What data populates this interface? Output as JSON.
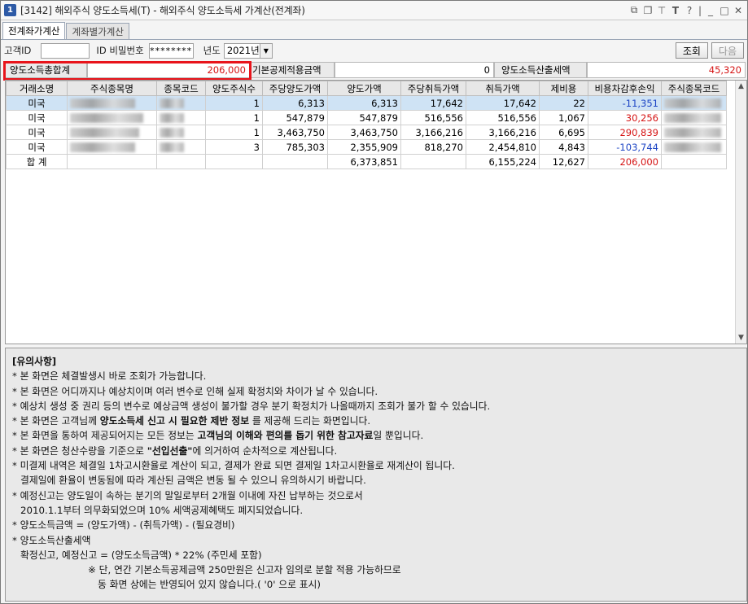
{
  "window": {
    "title_num": "1",
    "title": "[3142] 해외주식 양도소득세(T) - 해외주식 양도소득세 가계산(전계좌)"
  },
  "tabs": [
    "전계좌가계산",
    "계좌별가계산"
  ],
  "filters": {
    "customer_id_label": "고객ID",
    "id_pw_label": "ID 비밀번호",
    "id_pw_value": "********",
    "year_label": "년도",
    "year_value": "2021년",
    "query_button": "조회",
    "next_button": "다음"
  },
  "summary": {
    "total_gain_label": "양도소득총합계",
    "total_gain_value": "206,000",
    "basic_deduction_label": "기본공제적용금액",
    "basic_deduction_value": "0",
    "tax_label": "양도소득산출세액",
    "tax_value": "45,320"
  },
  "table": {
    "headers": [
      "거래소명",
      "주식종목명",
      "종목코드",
      "양도주식수",
      "주당양도가액",
      "양도가액",
      "주당취득가액",
      "취득가액",
      "제비용",
      "비용차감후손익",
      "주식종목코드"
    ],
    "rows": [
      {
        "market": "미국",
        "qty": "1",
        "unit_sell": "6,313",
        "sell": "6,313",
        "unit_buy": "17,642",
        "buy": "17,642",
        "fee": "22",
        "pnl": "-11,351",
        "pnl_color": "blue"
      },
      {
        "market": "미국",
        "qty": "1",
        "unit_sell": "547,879",
        "sell": "547,879",
        "unit_buy": "516,556",
        "buy": "516,556",
        "fee": "1,067",
        "pnl": "30,256",
        "pnl_color": "red"
      },
      {
        "market": "미국",
        "qty": "1",
        "unit_sell": "3,463,750",
        "sell": "3,463,750",
        "unit_buy": "3,166,216",
        "buy": "3,166,216",
        "fee": "6,695",
        "pnl": "290,839",
        "pnl_color": "red"
      },
      {
        "market": "미국",
        "qty": "3",
        "unit_sell": "785,303",
        "sell": "2,355,909",
        "unit_buy": "818,270",
        "buy": "2,454,810",
        "fee": "4,843",
        "pnl": "-103,744",
        "pnl_color": "blue"
      }
    ],
    "total": {
      "label": "합 계",
      "sell": "6,373,851",
      "buy": "6,155,224",
      "fee": "12,627",
      "pnl": "206,000"
    }
  },
  "notes": {
    "title": "[유의사항]",
    "l1": "* 본 화면은 체결발생시 바로 조회가 가능합니다.",
    "l2": "* 본 화면은 어디까지나 예상치이며 여러 변수로 인해 실제 확정치와 차이가 날 수 있습니다.",
    "l3": "* 예상치 생성 중 권리 등의 변수로 예상금액 생성이 불가할 경우 분기 확정치가 나올때까지 조회가 불가 할 수 있습니다.",
    "l4a": "* 본 화면은 고객님께 ",
    "l4b": "양도소득세 신고 시 필요한 제반 정보",
    "l4c": " 를 제공해 드리는 화면입니다.",
    "l5a": "* 본 화면을 통하여 제공되어지는 모든 정보는 ",
    "l5b": "고객님의 이해와 편의를 돕기 위한 참고자료",
    "l5c": "일 뿐입니다.",
    "l6a": "* 본 화면은 청산수량을 기준으로 ",
    "l6b": "\"선입선출\"",
    "l6c": "에 의거하여 순차적으로 계산됩니다.",
    "l7": "* 미결제 내역은 체결일 1차고시환율로 계산이 되고, 결제가 완료 되면 결제일 1차고시환율로 재계산이 됩니다.",
    "l8": "결제일에 환율이 변동됨에 따라 계산된 금액은 변동 될 수 있으니 유의하시기 바랍니다.",
    "l9": "* 예정신고는 양도일이 속하는 분기의 말일로부터 2개월 이내에 자진 납부하는 것으로서",
    "l10": "2010.1.1부터 의무화되었으며 10% 세액공제혜택도 폐지되었습니다.",
    "l11": "* 양도소득금액 = (양도가액) - (취득가액)  - (필요경비)",
    "l12": "* 양도소득산출세액",
    "l13": "확정신고, 예정신고 = (양도소득금액) * 22% (주민세 포함)",
    "l14": "※ 단, 연간 기본소득공제금액 250만원은 신고자 임의로 분할 적용 가능하므로",
    "l15": "동 화면 상에는 반영되어 있지 않습니다.( '0' 으로 표시)"
  },
  "icons": [
    "window-number-icon",
    "link-icon",
    "copy-icon",
    "pin-icon",
    "text-icon",
    "help-icon",
    "minimize-icon",
    "maximize-icon",
    "close-icon"
  ]
}
